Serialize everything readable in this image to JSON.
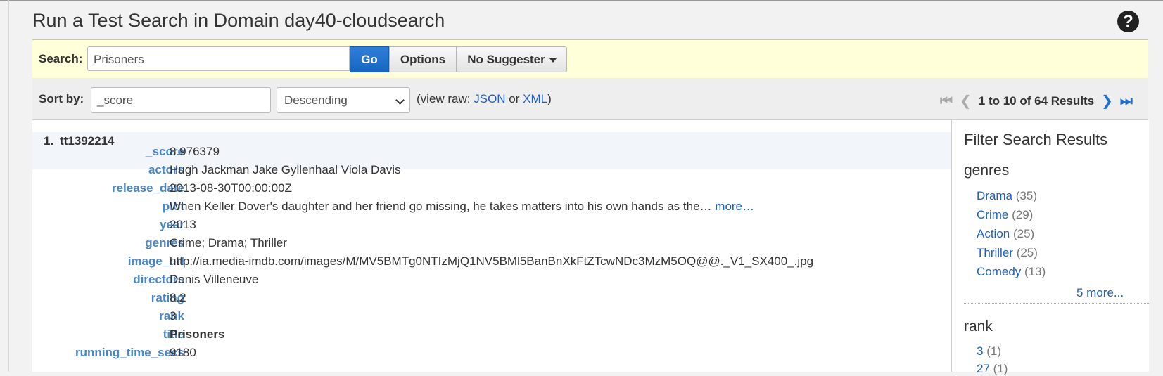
{
  "header": {
    "title": "Run a Test Search in Domain day40-cloudsearch",
    "help_icon": "?"
  },
  "search": {
    "label": "Search:",
    "value": "Prisoners",
    "go_label": "Go",
    "options_label": "Options",
    "suggester_label": "No Suggester"
  },
  "sort": {
    "label": "Sort by:",
    "value": "_score",
    "order": "Descending",
    "view_raw_prefix": "(view raw: ",
    "json_label": "JSON",
    "or_text": " or ",
    "xml_label": "XML",
    "view_raw_suffix": ")"
  },
  "pagination": {
    "text": "1 to 10 of 64 Results"
  },
  "result": {
    "number": "1.",
    "id": "tt1392214",
    "fields": [
      {
        "key": "_score",
        "value": "8.976379"
      },
      {
        "key": "actors",
        "value": "Hugh Jackman Jake Gyllenhaal Viola Davis"
      },
      {
        "key": "release_date",
        "value": "2013-08-30T00:00:00Z"
      },
      {
        "key": "plot",
        "value": "When Keller Dover's daughter and her friend go missing, he takes matters into his own hands as the…",
        "more": "more…"
      },
      {
        "key": "year",
        "value": "2013"
      },
      {
        "key": "genres",
        "value": "Crime; Drama; Thriller"
      },
      {
        "key": "image_url",
        "value": "http://ia.media-imdb.com/images/M/MV5BMTg0NTIzMjQ1NV5BMl5BanBnXkFtZTcwNDc3MzM5OQ@@._V1_SX400_.jpg"
      },
      {
        "key": "directors",
        "value": "Denis Villeneuve"
      },
      {
        "key": "rating",
        "value": "8.2"
      },
      {
        "key": "rank",
        "value": "3"
      },
      {
        "key": "title",
        "value": "Prisoners"
      },
      {
        "key": "running_time_secs",
        "value": "9180"
      }
    ]
  },
  "filters": {
    "title": "Filter Search Results",
    "genres": {
      "heading": "genres",
      "items": [
        {
          "label": "Drama",
          "count": "(35)"
        },
        {
          "label": "Crime",
          "count": "(29)"
        },
        {
          "label": "Action",
          "count": "(25)"
        },
        {
          "label": "Thriller",
          "count": "(25)"
        },
        {
          "label": "Comedy",
          "count": "(13)"
        }
      ],
      "more": "5 more..."
    },
    "rank": {
      "heading": "rank",
      "items": [
        {
          "label": "3",
          "count": "(1)"
        },
        {
          "label": "27",
          "count": "(1)"
        }
      ]
    }
  },
  "colors": {
    "link": "#1f5fbf",
    "field_key": "#4a86c7",
    "go_button": "#1766c2",
    "search_bar": "#ffffd9"
  }
}
